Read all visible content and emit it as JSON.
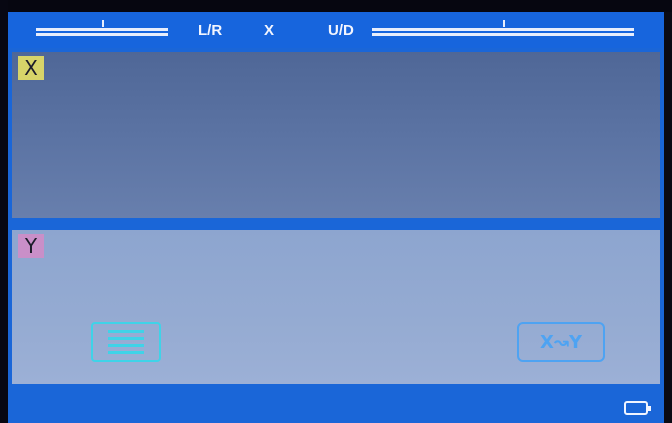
{
  "topbar": {
    "lr_label": "L/R",
    "axis_label": "X",
    "ud_label": "U/D"
  },
  "panel_x": {
    "label": "X"
  },
  "panel_y": {
    "label": "Y"
  },
  "controls": {
    "swap_label": "X↝Y"
  },
  "icons": [
    "menu-icon",
    "swap-xy-icon",
    "battery-icon"
  ],
  "colors": {
    "screen_blue": "#1a66d8",
    "x_chip": "#d7d469",
    "y_chip": "#c98fc8",
    "menu_cyan": "#3fd3e8",
    "swap_blue": "#4ea3f2"
  }
}
